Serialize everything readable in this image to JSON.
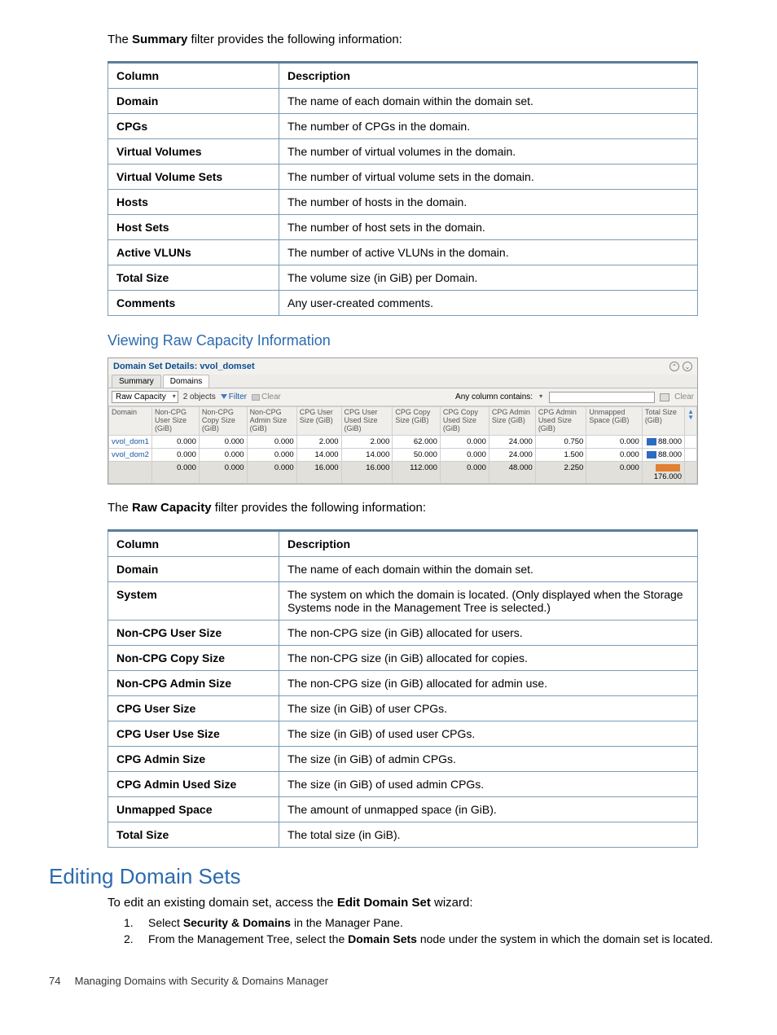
{
  "intro_summary_pre": "The ",
  "intro_summary_bold": "Summary",
  "intro_summary_post": " filter provides the following information:",
  "table_headers": {
    "c1": "Column",
    "c2": "Description"
  },
  "summary_rows": [
    {
      "c": "Domain",
      "d": "The name of each domain within the domain set."
    },
    {
      "c": "CPGs",
      "d": "The number of CPGs in the domain."
    },
    {
      "c": "Virtual Volumes",
      "d": "The number of virtual volumes in the domain."
    },
    {
      "c": "Virtual Volume Sets",
      "d": "The number of virtual volume sets in the domain."
    },
    {
      "c": "Hosts",
      "d": "The number of hosts in the domain."
    },
    {
      "c": "Host Sets",
      "d": "The number of host sets in the domain."
    },
    {
      "c": "Active VLUNs",
      "d": "The number of active VLUNs in the domain."
    },
    {
      "c": "Total Size",
      "d": "The volume size (in GiB) per Domain."
    },
    {
      "c": "Comments",
      "d": "Any user-created comments."
    }
  ],
  "h3_raw": "Viewing Raw Capacity Information",
  "panel": {
    "title": "Domain Set Details: vvol_domset",
    "tabs": {
      "summary": "Summary",
      "domains": "Domains"
    },
    "dropdown": "Raw Capacity",
    "count": "2 objects",
    "filter": "Filter",
    "clear": "Clear",
    "any_col": "Any column contains:",
    "clear2": "Clear",
    "headers": [
      "Domain",
      "Non-CPG User Size (GiB)",
      "Non-CPG Copy Size (GiB)",
      "Non-CPG Admin Size (GiB)",
      "CPG User Size (GiB)",
      "CPG User Used Size (GiB)",
      "CPG Copy Size (GiB)",
      "CPG Copy Used Size (GiB)",
      "CPG Admin Size (GiB)",
      "CPG Admin Used Size (GiB)",
      "Unmapped Space (GiB)",
      "Total Size (GiB)"
    ],
    "rows": [
      {
        "domain": "vvol_dom1",
        "v": [
          "0.000",
          "0.000",
          "0.000",
          "2.000",
          "2.000",
          "62.000",
          "0.000",
          "24.000",
          "0.750",
          "0.000",
          "88.000"
        ],
        "bar": "blue"
      },
      {
        "domain": "vvol_dom2",
        "v": [
          "0.000",
          "0.000",
          "0.000",
          "14.000",
          "14.000",
          "50.000",
          "0.000",
          "24.000",
          "1.500",
          "0.000",
          "88.000"
        ],
        "bar": "blue"
      }
    ],
    "total": {
      "v": [
        "0.000",
        "0.000",
        "0.000",
        "16.000",
        "16.000",
        "112.000",
        "0.000",
        "48.000",
        "2.250",
        "0.000",
        "176.000"
      ],
      "bar": "orange"
    }
  },
  "intro_raw_pre": "The ",
  "intro_raw_bold": "Raw Capacity",
  "intro_raw_post": " filter provides the following information:",
  "raw_rows": [
    {
      "c": "Domain",
      "d": "The name of each domain within the domain set."
    },
    {
      "c": "System",
      "d": "The system on which the domain is located. (Only displayed when the Storage Systems node in the Management Tree is selected.)"
    },
    {
      "c": "Non-CPG User Size",
      "d": "The non-CPG size (in GiB) allocated for users."
    },
    {
      "c": "Non-CPG Copy Size",
      "d": "The non-CPG size (in GiB) allocated for copies."
    },
    {
      "c": "Non-CPG Admin Size",
      "d": "The non-CPG size (in GiB) allocated for admin use."
    },
    {
      "c": "CPG User Size",
      "d": "The size (in GiB) of user CPGs."
    },
    {
      "c": "CPG User Use Size",
      "d": "The size (in GiB) of used user CPGs."
    },
    {
      "c": "CPG Admin Size",
      "d": "The size (in GiB) of admin CPGs."
    },
    {
      "c": "CPG Admin Used Size",
      "d": "The size (in GiB) of used admin CPGs."
    },
    {
      "c": "Unmapped Space",
      "d": "The amount of unmapped space (in GiB)."
    },
    {
      "c": "Total Size",
      "d": "The total size (in GiB)."
    }
  ],
  "h2_edit": "Editing Domain Sets",
  "edit_intro_pre": "To edit an existing domain set, access the ",
  "edit_intro_bold": "Edit Domain Set",
  "edit_intro_post": " wizard:",
  "steps": {
    "n1": "1.",
    "t1_pre": "Select ",
    "t1_bold": "Security & Domains",
    "t1_post": " in the Manager Pane.",
    "n2": "2.",
    "t2_pre": "From the Management Tree, select the ",
    "t2_bold": "Domain Sets",
    "t2_post": " node under the system in which the domain set is located."
  },
  "footer": {
    "page": "74",
    "title": "Managing Domains with Security & Domains Manager"
  }
}
